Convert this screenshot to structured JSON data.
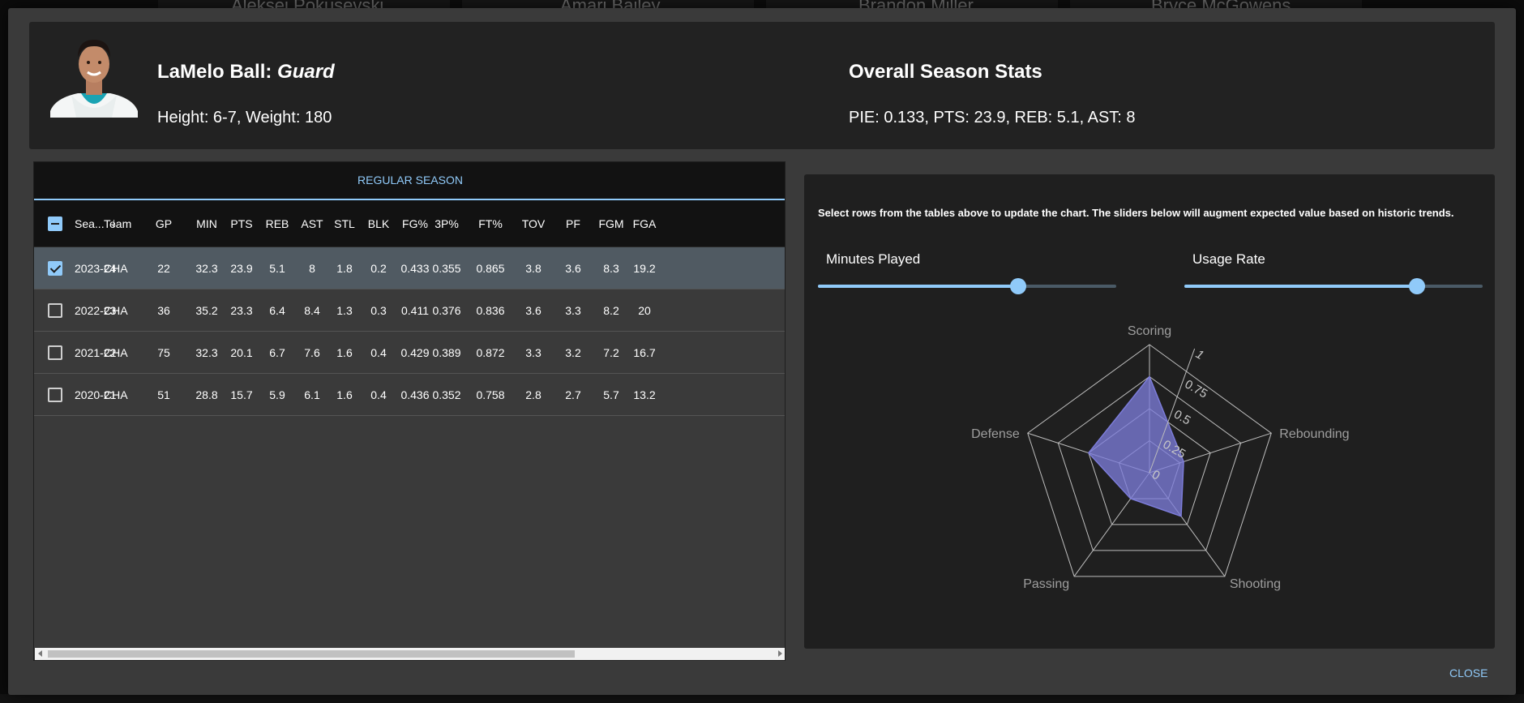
{
  "background": {
    "player_names": [
      "Aleksei Pokusevski",
      "Amari Bailey",
      "Brandon Miller",
      "Bryce McGowens"
    ]
  },
  "player": {
    "name": "LaMelo Ball",
    "position": "Guard",
    "size_text": "Height: 6-7, Weight: 180",
    "avatar_icon": "player-headshot"
  },
  "overall": {
    "title": "Overall Season Stats",
    "stats_text": "PIE: 0.133, PTS: 23.9, REB: 5.1, AST: 8"
  },
  "table": {
    "tab_label": "REGULAR SEASON",
    "columns": [
      "Sea...",
      "Team",
      "GP",
      "MIN",
      "PTS",
      "REB",
      "AST",
      "STL",
      "BLK",
      "FG%",
      "3P%",
      "FT%",
      "TOV",
      "PF",
      "FGM",
      "FGA"
    ],
    "rows": [
      {
        "selected": true,
        "cells": [
          "2023-24",
          "CHA",
          "22",
          "32.3",
          "23.9",
          "5.1",
          "8",
          "1.8",
          "0.2",
          "0.433",
          "0.355",
          "0.865",
          "3.8",
          "3.6",
          "8.3",
          "19.2"
        ]
      },
      {
        "selected": false,
        "cells": [
          "2022-23",
          "CHA",
          "36",
          "35.2",
          "23.3",
          "6.4",
          "8.4",
          "1.3",
          "0.3",
          "0.411",
          "0.376",
          "0.836",
          "3.6",
          "3.3",
          "8.2",
          "20"
        ]
      },
      {
        "selected": false,
        "cells": [
          "2021-22",
          "CHA",
          "75",
          "32.3",
          "20.1",
          "6.7",
          "7.6",
          "1.6",
          "0.4",
          "0.429",
          "0.389",
          "0.872",
          "3.3",
          "3.2",
          "7.2",
          "16.7"
        ]
      },
      {
        "selected": false,
        "cells": [
          "2020-21",
          "CHA",
          "51",
          "28.8",
          "15.7",
          "5.9",
          "6.1",
          "1.6",
          "0.4",
          "0.436",
          "0.352",
          "0.758",
          "2.8",
          "2.7",
          "5.7",
          "13.2"
        ]
      }
    ],
    "sort_icon": "arrow-down-icon",
    "header_checkbox_state": "indeterminate"
  },
  "chart_panel": {
    "instructions": "Select rows from the tables above to update the chart. The sliders below will augment expected value based on historic trends.",
    "sliders": [
      {
        "label": "Minutes Played",
        "value": 0.67
      },
      {
        "label": "Usage Rate",
        "value": 0.78
      }
    ]
  },
  "chart_data": {
    "type": "radar",
    "axes": [
      "Scoring",
      "Rebounding",
      "Shooting",
      "Passing",
      "Defense"
    ],
    "series": [
      {
        "values": [
          0.75,
          0.28,
          0.42,
          0.25,
          0.5
        ],
        "color": "#7c7cd9"
      }
    ],
    "rlim": [
      0,
      1
    ],
    "ticks": [
      "0",
      "0.25",
      "0.5",
      "0.75",
      "1"
    ],
    "grid": true
  },
  "footer": {
    "close_label": "Close"
  },
  "colors": {
    "accent": "#90caf9",
    "panel": "#222222",
    "radar_fill": "#7c7cd9"
  }
}
